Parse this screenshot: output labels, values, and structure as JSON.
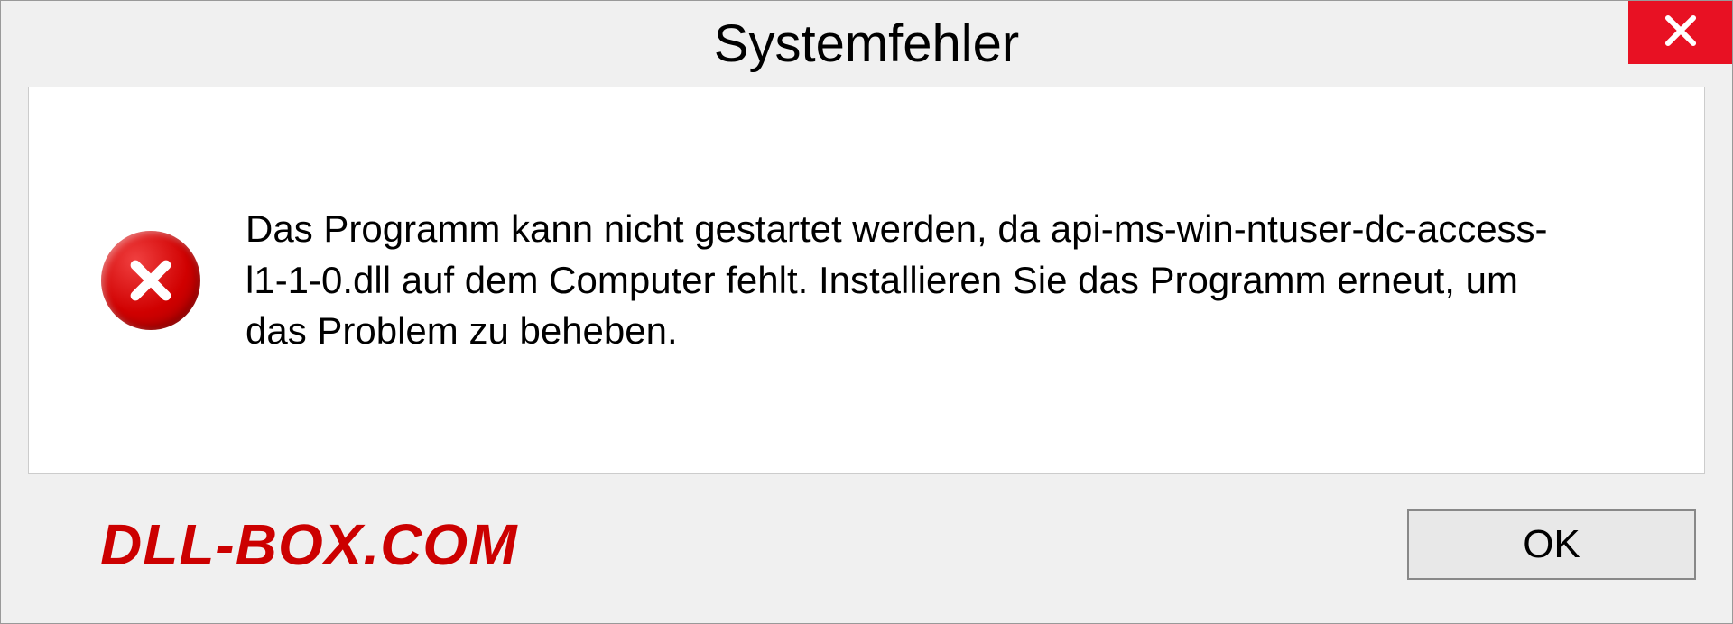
{
  "dialog": {
    "title": "Systemfehler",
    "message": "Das Programm kann nicht gestartet werden, da api-ms-win-ntuser-dc-access-l1-1-0.dll auf dem Computer fehlt. Installieren Sie das Programm erneut, um das Problem zu beheben.",
    "ok_label": "OK"
  },
  "watermark": "DLL-BOX.COM"
}
